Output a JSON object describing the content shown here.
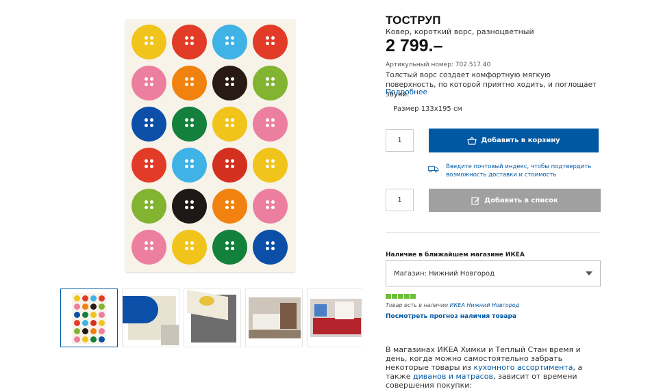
{
  "product": {
    "name": "ТОСТРУП",
    "subtitle": "Ковер, короткий ворс, разноцветный",
    "price": "2 799.–",
    "article": "Артикульный номер: 702.517.40",
    "description": "Толстый ворс создает комфортную мягкую поверхность, по которой приятно ходить, и поглощает звуки.",
    "more_link": "Подробнее",
    "size": "Размер 133x195 см"
  },
  "rug_colors": [
    "#f0c41b",
    "#e23c28",
    "#3fb2e6",
    "#e23c28",
    "#ec7fa0",
    "#f2820f",
    "#2a1a16",
    "#82b432",
    "#0b4fa8",
    "#13803c",
    "#f0c41b",
    "#ec7fa0",
    "#e23c28",
    "#3fb2e6",
    "#d4301f",
    "#f0c41b",
    "#82b432",
    "#1e1816",
    "#f2820f",
    "#ec7fa0",
    "#ec7fa0",
    "#f0c41b",
    "#13803c",
    "#0b4fa8"
  ],
  "purchase": {
    "qty1": "1",
    "add_to_cart": "Добавить в корзину",
    "delivery_text": "Введите почтовый индекс, чтобы подтвердить возможность доставки и стоимость",
    "qty2": "1",
    "add_to_list": "Добавить в список"
  },
  "availability": {
    "title": "Наличие в ближайшем магазине ИКЕА",
    "store_label": "Магазин:",
    "store_value": "Нижний Новгород",
    "stock_prefix": "Товар есть в наличии",
    "stock_store": "ИКЕА Нижний Новгород",
    "forecast_link": "Посмотреть прогноз наличия товара"
  },
  "promo": {
    "text1": "В магазинах ИКЕА Химки и Теплый Стан время и день, когда можно самостоятельно забрать некоторые товары из",
    "link1": "кухонного ассортимента",
    "text2": ", а также",
    "link2": "диванов и матрасов",
    "text3": ", зависит от времени совершения покупки:"
  },
  "colors": {
    "accent_blue": "#0058a3",
    "disabled_gray": "#a0a0a0",
    "stock_green": "#6dbf3a"
  },
  "icons": {
    "cart": "basket-icon",
    "list": "add-to-list-icon",
    "delivery": "truck-icon",
    "dropdown": "caret-down-icon"
  }
}
